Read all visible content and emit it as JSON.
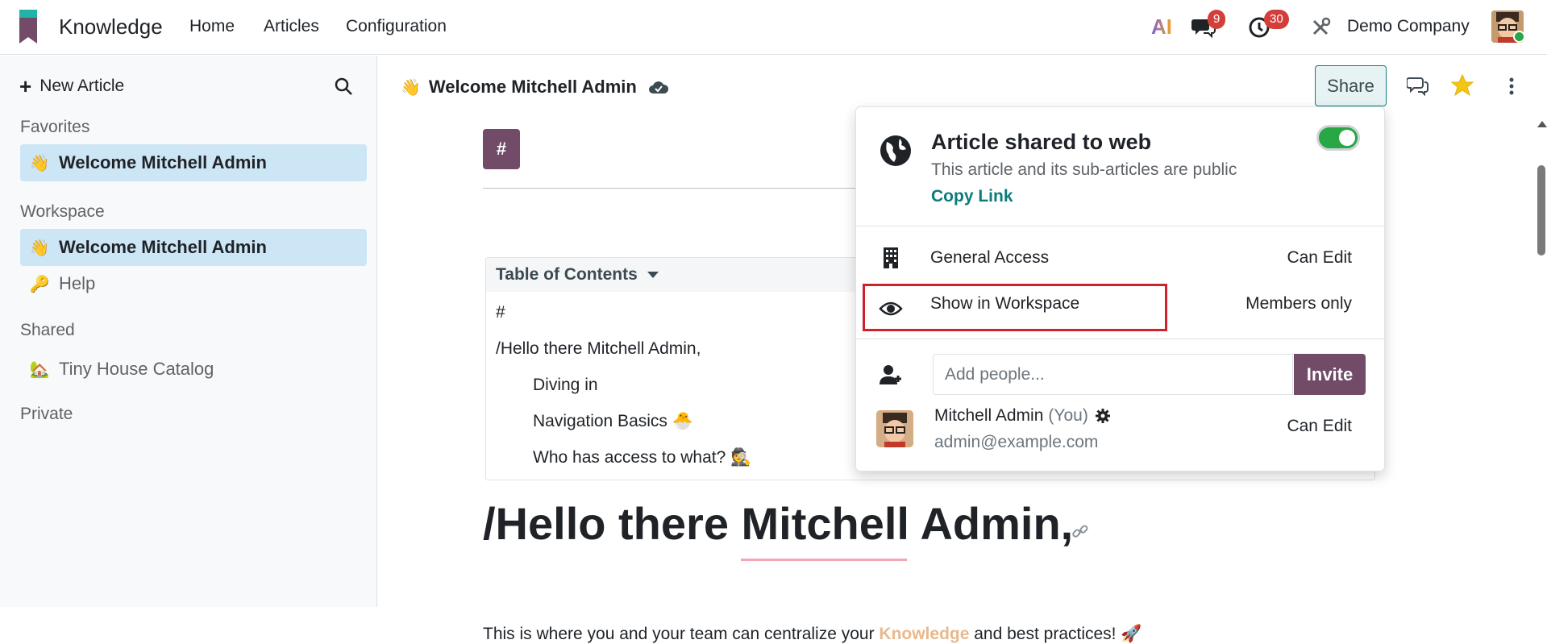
{
  "navbar": {
    "app_name": "Knowledge",
    "menu": [
      "Home",
      "Articles",
      "Configuration"
    ],
    "ai_label": "AI",
    "messages_badge": "9",
    "activity_badge": "30",
    "company": "Demo Company",
    "colors": {
      "brand": "#714b67",
      "badge": "#d23f3a"
    }
  },
  "sidebar": {
    "new_article": "New Article",
    "sections": {
      "favorites": "Favorites",
      "workspace": "Workspace",
      "shared": "Shared",
      "private": "Private"
    },
    "favorites_items": [
      {
        "emoji": "👋",
        "label": "Welcome Mitchell Admin"
      }
    ],
    "workspace_items": [
      {
        "emoji": "👋",
        "label": "Welcome Mitchell Admin"
      },
      {
        "emoji": "🔑",
        "label": "Help"
      }
    ],
    "shared_items": [
      {
        "emoji": "🏡",
        "label": "Tiny House Catalog"
      }
    ]
  },
  "article": {
    "emoji": "👋",
    "title": "Welcome Mitchell Admin",
    "share_label": "Share",
    "hash_block": "#",
    "toc": {
      "header": "Table of Contents",
      "items": [
        {
          "text": "#"
        },
        {
          "text": "/Hello there Mitchell Admin,"
        },
        {
          "text": "Diving in"
        },
        {
          "text": "Navigation Basics 🐣"
        },
        {
          "text": "Who has access to what? 🕵️"
        }
      ]
    },
    "heading": "/Hello there Mitchell Admin,",
    "body_before": "This is where you and your team can centralize your ",
    "body_highlight": "Knowledge",
    "body_after": " and best practices! 🚀"
  },
  "share_popover": {
    "title": "Article shared to web",
    "subtitle": "This article and its sub-articles are public",
    "copy_link": "Copy Link",
    "toggle_on": true,
    "general_access_label": "General Access",
    "general_access_value": "Can Edit",
    "workspace_label": "Show in Workspace",
    "workspace_value": "Members only",
    "add_people_placeholder": "Add people...",
    "invite_label": "Invite",
    "member": {
      "name": "Mitchell Admin",
      "you": "(You)",
      "email": "admin@example.com",
      "permission": "Can Edit"
    }
  }
}
